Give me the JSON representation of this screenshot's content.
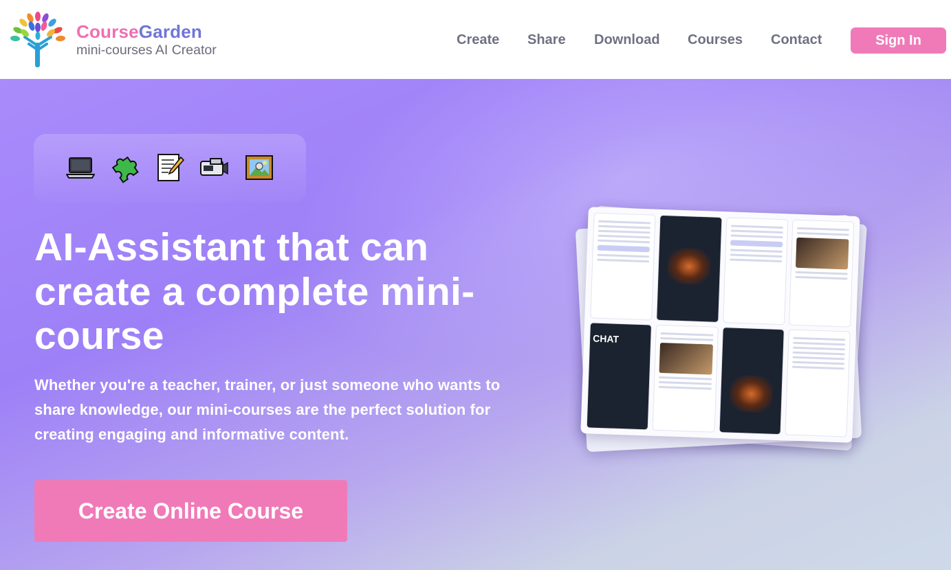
{
  "brand": {
    "name_part1": "Course",
    "name_part2": "Garden",
    "tagline": "mini-courses AI Creator"
  },
  "nav": {
    "items": [
      {
        "label": "Create"
      },
      {
        "label": "Share"
      },
      {
        "label": "Download"
      },
      {
        "label": "Courses"
      },
      {
        "label": "Contact"
      }
    ],
    "sign_in_label": "Sign In"
  },
  "hero": {
    "icons": [
      "laptop-icon",
      "puzzle-piece-icon",
      "memo-icon",
      "video-camera-icon",
      "framed-picture-icon"
    ],
    "headline": "AI-Assistant that can create a complete mini-course",
    "subtext": "Whether you're a teacher, trainer, or just someone who wants to share knowledge, our mini-courses are the perfect solution for creating engaging and informative content.",
    "cta_label": "Create Online Course",
    "preview_chat_label": "CHAT"
  },
  "colors": {
    "brand_pink": "#f06fb0",
    "brand_blue": "#6f76d8",
    "button_pink": "#f07ab8",
    "nav_text": "#6f7182",
    "hero_purple": "#9d80f7"
  }
}
